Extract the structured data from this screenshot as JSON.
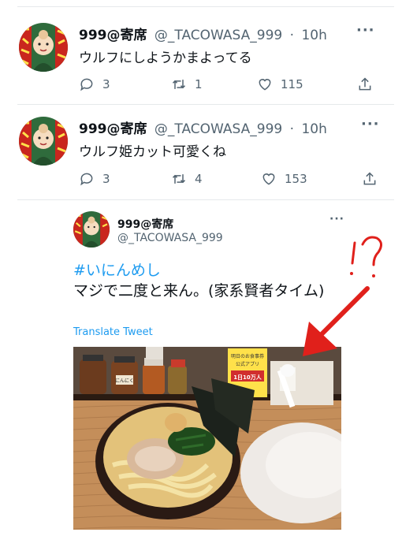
{
  "tweets": [
    {
      "name": "999@寄席",
      "handle": "@_TACOWASA_999",
      "dot": "·",
      "time": "10h",
      "text": "ウルフにしようかまよってる",
      "replies": "3",
      "retweets": "1",
      "likes": "115"
    },
    {
      "name": "999@寄席",
      "handle": "@_TACOWASA_999",
      "dot": "·",
      "time": "10h",
      "text": "ウルフ姫カット可愛くね",
      "replies": "3",
      "retweets": "4",
      "likes": "153"
    }
  ],
  "quoted": {
    "name": "999@寄席",
    "handle": "@_TACOWASA_999",
    "hashtag": "#いにんめし",
    "body": "マジで二度と来ん。(家系賢者タイム)",
    "translate": "Translate Tweet",
    "annotation": "!?",
    "photo_labels": {
      "poster_line1": "明日のお食事券",
      "poster_line2": "公式アプリ",
      "poster_big": "1日10万人",
      "jar_label": "にんにく"
    }
  },
  "colors": {
    "accent": "#1d9bf0",
    "annotation": "#e0201b",
    "muted": "#536471"
  }
}
